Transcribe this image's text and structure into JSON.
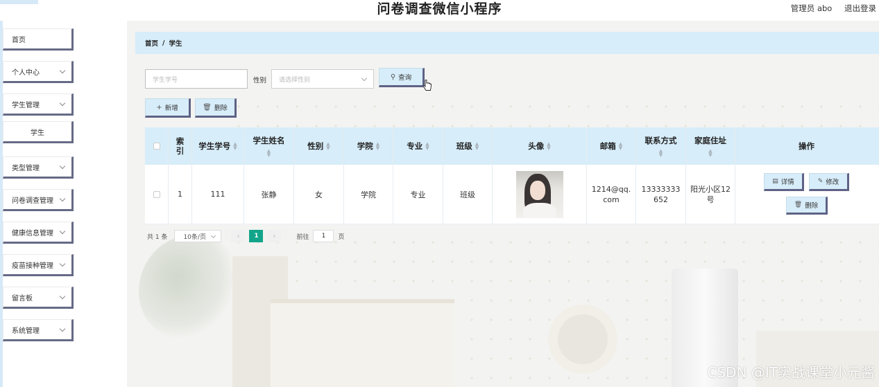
{
  "header": {
    "title": "问卷调查微信小程序",
    "user_label": "管理员 abo",
    "logout_label": "退出登录"
  },
  "sidebar": {
    "items": [
      {
        "label": "首页"
      },
      {
        "label": "个人中心"
      },
      {
        "label": "学生管理"
      },
      {
        "label": "学生"
      },
      {
        "label": "类型管理"
      },
      {
        "label": "问卷调查管理"
      },
      {
        "label": "健康信息管理"
      },
      {
        "label": "疫苗接种管理"
      },
      {
        "label": "留言板"
      },
      {
        "label": "系统管理"
      }
    ]
  },
  "breadcrumb": {
    "home": "首页",
    "separator": "/",
    "current": "学生"
  },
  "search": {
    "student_no_placeholder": "学生学号",
    "gender_label": "性别",
    "gender_placeholder": "请选择性别",
    "query_label": "查询",
    "add_label": "新增",
    "delete_label": "删除"
  },
  "table": {
    "headers": {
      "index": "索引",
      "student_no": "学生学号",
      "student_name": "学生姓名",
      "gender": "性别",
      "college": "学院",
      "major": "专业",
      "class": "班级",
      "avatar": "头像",
      "email": "邮箱",
      "phone": "联系方式",
      "address": "家庭住址",
      "actions": "操作"
    },
    "rows": [
      {
        "index": "1",
        "student_no": "111",
        "student_name": "张静",
        "gender": "女",
        "college": "学院",
        "major": "专业",
        "class": "班级",
        "email": "1214@qq.com",
        "phone": "13333333652",
        "address": "阳光小区12号"
      }
    ],
    "actions": {
      "detail": "详情",
      "edit": "修改",
      "delete": "删除"
    }
  },
  "pagination": {
    "total": "共 1 条",
    "page_size": "10条/页",
    "current_page": "1",
    "goto_prefix": "前往",
    "goto_value": "1",
    "goto_suffix": "页"
  },
  "watermark": "CSDN @IT实战课堂小元酱",
  "colors": {
    "header_blue": "#d7edf9",
    "button_shadow": "#5e6285",
    "pager_active": "#12a58a"
  }
}
